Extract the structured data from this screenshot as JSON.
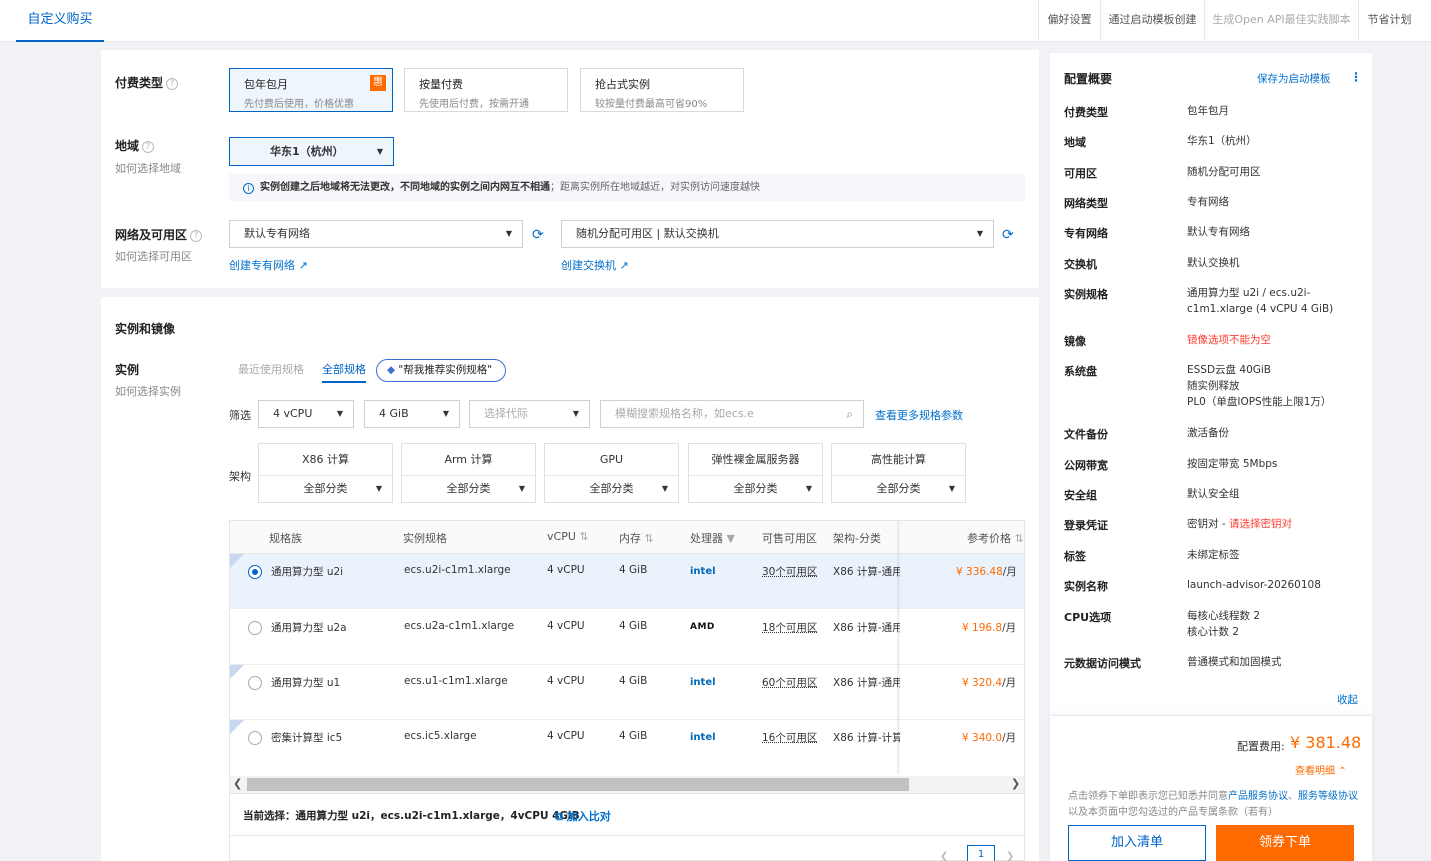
{
  "tabs": {
    "active": "自定义购买"
  },
  "top_links": [
    "偏好设置",
    "通过启动模板创建",
    "生成Open API最佳实践脚本",
    "节省计划"
  ],
  "billing": {
    "label": "付费类型",
    "options": [
      {
        "title": "包年包月",
        "desc": "先付费后使用，价格优惠",
        "badge": "惠"
      },
      {
        "title": "按量付费",
        "desc": "先使用后付费，按需开通"
      },
      {
        "title": "抢占式实例",
        "desc": "较按量付费最高可省90%"
      }
    ]
  },
  "region": {
    "label": "地域",
    "help": "如何选择地域",
    "value": "华东1（杭州）",
    "note_bold": "实例创建之后地域将无法更改，不同地域的实例之间内网互不相通",
    "note_rest": "；距离实例所在地域越近，对实例访问速度越快"
  },
  "network": {
    "label": "网络及可用区",
    "help": "如何选择可用区",
    "vpc": "默认专有网络",
    "zone": "随机分配可用区 | 默认交换机",
    "create_vpc": "创建专有网络",
    "create_vswitch": "创建交换机"
  },
  "instance": {
    "section": "实例和镜像",
    "label": "实例",
    "help": "如何选择实例",
    "subtabs": [
      "最近使用规格",
      "全部规格"
    ],
    "recommend": "\"帮我推荐实例规格\"",
    "filter_label": "筛选",
    "filters": {
      "vcpu": "4 vCPU",
      "mem": "4 GiB",
      "gen_placeholder": "选择代际",
      "search_placeholder": "模糊搜索规格名称，如ecs.e"
    },
    "more_params": "查看更多规格参数",
    "arch_label": "架构",
    "archs": [
      {
        "name": "X86 计算",
        "sub": "全部分类"
      },
      {
        "name": "Arm 计算",
        "sub": "全部分类"
      },
      {
        "name": "GPU",
        "sub": "全部分类"
      },
      {
        "name": "弹性裸金属服务器",
        "sub": "全部分类"
      },
      {
        "name": "高性能计算",
        "sub": "全部分类"
      }
    ],
    "columns": [
      "规格族",
      "实例规格",
      "vCPU",
      "内存",
      "处理器",
      "可售可用区",
      "架构-分类",
      "参考价格"
    ],
    "rows": [
      {
        "family": "通用算力型 u2i",
        "spec": "ecs.u2i-c1m1.xlarge",
        "vcpu": "4 vCPU",
        "mem": "4 GiB",
        "cpu": "intel",
        "zones": "30个可用区",
        "arch": "X86 计算-通用",
        "price": "¥ 336.48",
        "unit": "/月"
      },
      {
        "family": "通用算力型 u2a",
        "spec": "ecs.u2a-c1m1.xlarge",
        "vcpu": "4 vCPU",
        "mem": "4 GiB",
        "cpu": "AMD",
        "zones": "18个可用区",
        "arch": "X86 计算-通用",
        "price": "¥ 196.8",
        "unit": "/月"
      },
      {
        "family": "通用算力型 u1",
        "spec": "ecs.u1-c1m1.xlarge",
        "vcpu": "4 vCPU",
        "mem": "4 GiB",
        "cpu": "intel",
        "zones": "60个可用区",
        "arch": "X86 计算-通用",
        "price": "¥ 320.4",
        "unit": "/月"
      },
      {
        "family": "密集计算型 ic5",
        "spec": "ecs.ic5.xlarge",
        "vcpu": "4 vCPU",
        "mem": "4 GiB",
        "cpu": "intel",
        "zones": "16个可用区",
        "arch": "X86 计算-计算",
        "price": "¥ 340.0",
        "unit": "/月"
      }
    ],
    "current_label": "当前选择：",
    "current_value": "通用算力型 u2i，ecs.u2i-c1m1.xlarge，4vCPU 4GiB",
    "compare": "加入比对",
    "page": "1"
  },
  "summary": {
    "title": "配置概要",
    "save_template": "保存为启动模板",
    "items": [
      {
        "k": "付费类型",
        "v": "包年包月"
      },
      {
        "k": "地域",
        "v": "华东1（杭州）"
      },
      {
        "k": "可用区",
        "v": "随机分配可用区"
      },
      {
        "k": "网络类型",
        "v": "专有网络"
      },
      {
        "k": "专有网络",
        "v": "默认专有网络"
      },
      {
        "k": "交换机",
        "v": "默认交换机"
      },
      {
        "k": "实例规格",
        "v": "通用算力型 u2i / ecs.u2i-c1m1.xlarge (4 vCPU 4 GiB)"
      },
      {
        "k": "镜像",
        "v": "镜像选项不能为空"
      },
      {
        "k": "系统盘",
        "v": "ESSD云盘 40GiB\n随实例释放\nPL0（单盘IOPS性能上限1万）"
      },
      {
        "k": "文件备份",
        "v": "激活备份"
      },
      {
        "k": "公网带宽",
        "v": "按固定带宽 5Mbps"
      },
      {
        "k": "安全组",
        "v": "默认安全组"
      },
      {
        "k": "登录凭证",
        "v": "密钥对 - ",
        "v_red": "请选择密钥对"
      },
      {
        "k": "标签",
        "v": "未绑定标签"
      },
      {
        "k": "实例名称",
        "v": "launch-advisor-20260108"
      },
      {
        "k": "CPU选项",
        "v": "每核心线程数 2\n核心计数 2"
      },
      {
        "k": "元数据访问模式",
        "v": "普通模式和加固模式"
      }
    ],
    "collapse": "收起",
    "fee_label": "配置费用:",
    "fee_value": "¥ 381.48",
    "detail": "查看明细",
    "agree_prefix": "点击领券下单即表示您已知悉并同意",
    "agree_link1": "产品服务协议",
    "agree_mid": "、",
    "agree_link2": "服务等级协议",
    "agree_suffix": "以及本页面中您勾选过的产品专属条款（若有）",
    "btn_cart": "加入清单",
    "btn_buy": "领券下单"
  },
  "colors": {
    "primary": "#0064c8",
    "accent": "#ff6a00",
    "error": "#ff3b30"
  }
}
